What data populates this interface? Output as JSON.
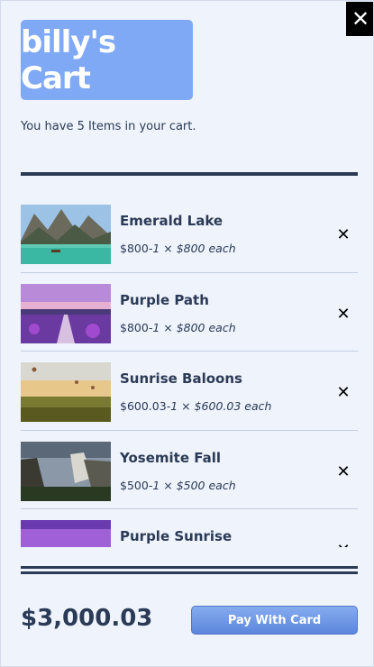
{
  "close": {
    "label": "✕"
  },
  "brand": {
    "title": "billy's Cart"
  },
  "summary": {
    "text": "You have 5 Items in your cart."
  },
  "items": [
    {
      "name": "Emerald Lake",
      "price": "$800",
      "qty": "-1 × $800 each",
      "remove": "✕",
      "thumbnail": "lake-image"
    },
    {
      "name": "Purple Path",
      "price": "$800",
      "qty": "-1 × $800 each",
      "remove": "✕",
      "thumbnail": "sunset-path-image"
    },
    {
      "name": "Sunrise Baloons",
      "price": "$600.03",
      "qty": "-1 × $600.03 each",
      "remove": "✕",
      "thumbnail": "balloons-image"
    },
    {
      "name": "Yosemite Fall",
      "price": "$500",
      "qty": "-1 × $500 each",
      "remove": "✕",
      "thumbnail": "valley-image"
    },
    {
      "name": "Purple Sunrise",
      "price": "",
      "qty": "",
      "remove": "✕",
      "thumbnail": "purple-sky-image"
    }
  ],
  "footer": {
    "total": "$3,000.03",
    "pay_label": "Pay With Card"
  },
  "colors": {
    "accent": "#7fa8f5",
    "text": "#2b3a55",
    "background": "#eef3fc",
    "button": "#5b86dc"
  }
}
